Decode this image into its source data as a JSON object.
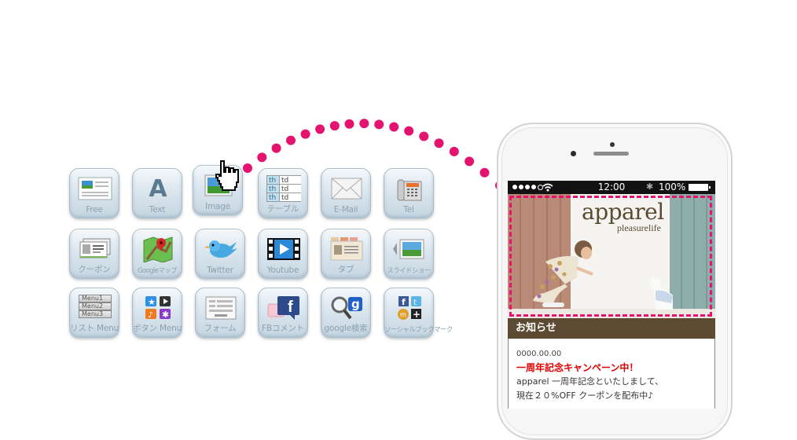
{
  "palette": {
    "accent_pink": "#e4136f",
    "tile_label": "#8aa0b0",
    "notice_header_bg": "#5c4a32",
    "notice_title_red": "#e00000"
  },
  "widget_grid": {
    "rows": [
      [
        {
          "label": "Free",
          "icon": "free-layout-icon"
        },
        {
          "label": "Text",
          "icon": "text-a-icon"
        },
        {
          "label": "Image",
          "icon": "image-icon"
        },
        {
          "label": "テーブル",
          "icon": "table-icon"
        },
        {
          "label": "E-Mail",
          "icon": "envelope-icon"
        },
        {
          "label": "Tel",
          "icon": "telephone-icon"
        }
      ],
      [
        {
          "label": "クーポン",
          "icon": "coupon-icon"
        },
        {
          "label": "Googleマップ",
          "icon": "google-map-icon"
        },
        {
          "label": "Twitter",
          "icon": "twitter-bird-icon"
        },
        {
          "label": "Youtube",
          "icon": "video-film-icon"
        },
        {
          "label": "タブ",
          "icon": "tab-folder-icon"
        },
        {
          "label": "スライドショー",
          "icon": "slideshow-icon"
        }
      ],
      [
        {
          "label": "リスト Menu",
          "icon": "list-menu-icon"
        },
        {
          "label": "ボタン Menu",
          "icon": "button-menu-icon"
        },
        {
          "label": "フォーム",
          "icon": "form-icon"
        },
        {
          "label": "FBコメント",
          "icon": "facebook-comment-icon"
        },
        {
          "label": "google検索",
          "icon": "google-search-icon"
        },
        {
          "label": "ソーシャルブックマーク",
          "icon": "social-bookmark-icon"
        }
      ]
    ],
    "table_icon_cells": [
      [
        "th",
        "td"
      ],
      [
        "th",
        "td"
      ],
      [
        "th",
        "td"
      ]
    ],
    "list_menu_items": [
      "Menu1",
      "Menu2",
      "Menu3"
    ]
  },
  "drag": {
    "cursor": "hand-pointer-icon",
    "from": "Image",
    "to": "phone-hero-image"
  },
  "phone": {
    "status_bar": {
      "time": "12:00",
      "battery": "100%"
    },
    "hero": {
      "brand": "apparel",
      "tagline": "pleasurelife"
    },
    "notice": {
      "header": "お知らせ",
      "date": "0000.00.00",
      "title": "一周年記念キャンペーン中！",
      "lines": [
        "apparel 一周年記念といたしまして、",
        "現在２０%OFF クーポンを配布中♪"
      ]
    }
  }
}
